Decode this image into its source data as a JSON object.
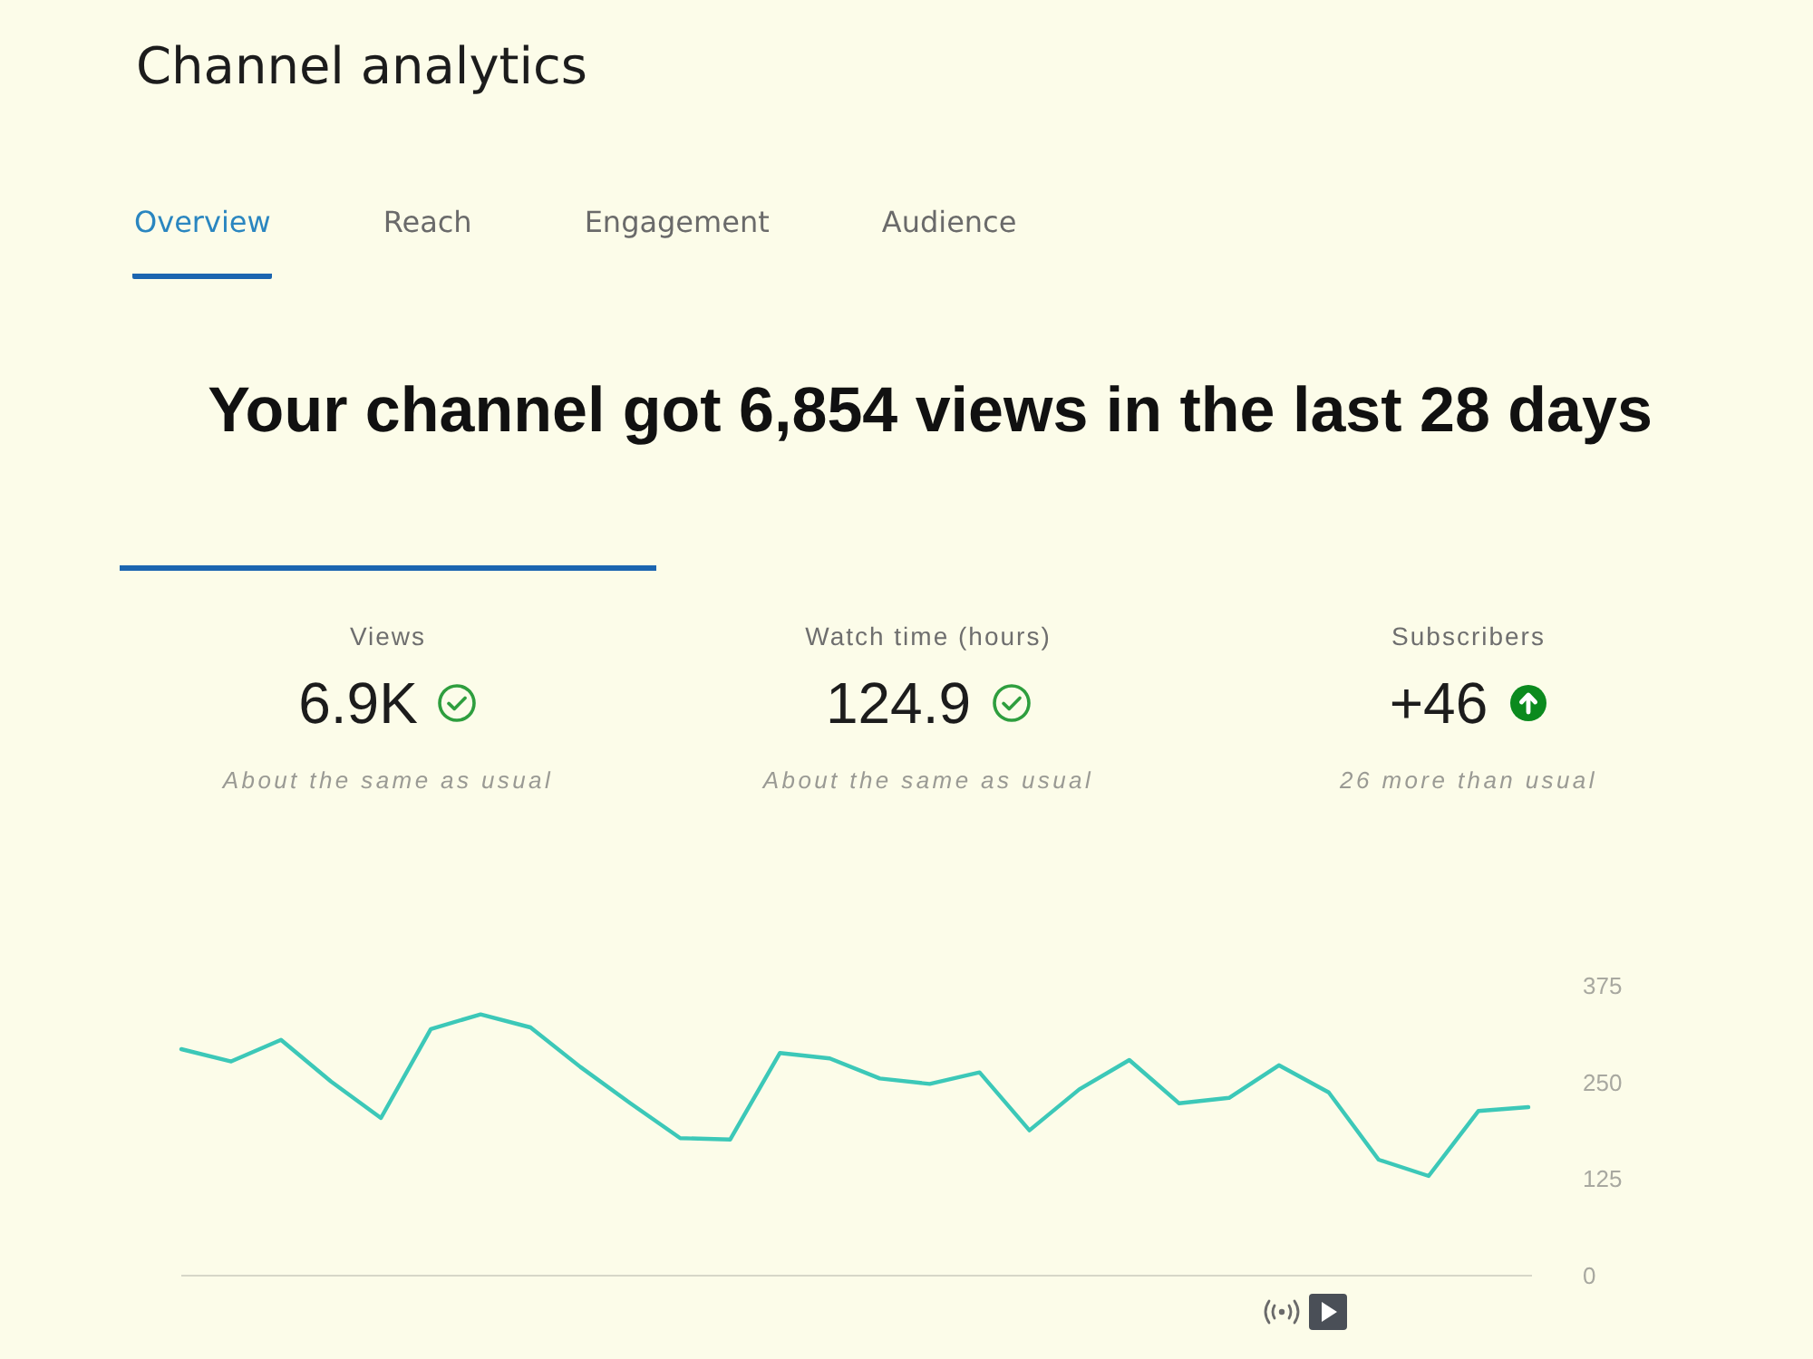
{
  "page": {
    "title": "Channel analytics"
  },
  "tabs": [
    {
      "label": "Overview",
      "selected": true
    },
    {
      "label": "Reach",
      "selected": false
    },
    {
      "label": "Engagement",
      "selected": false
    },
    {
      "label": "Audience",
      "selected": false
    }
  ],
  "headline": "Your channel got 6,854 views in the last 28 days",
  "metrics": [
    {
      "label": "Views",
      "value": "6.9K",
      "kind": "check",
      "note": "About the same as usual",
      "selected": true
    },
    {
      "label": "Watch time (hours)",
      "value": "124.9",
      "kind": "check",
      "note": "About the same as usual",
      "selected": false
    },
    {
      "label": "Subscribers",
      "value": "+46",
      "kind": "up",
      "note": "26 more than usual",
      "selected": false
    }
  ],
  "chart": {
    "chart_data": {
      "type": "line",
      "values": [
        293,
        277,
        305,
        251,
        204,
        319,
        338,
        321,
        270,
        223,
        178,
        176,
        288,
        281,
        255,
        248,
        263,
        188,
        241,
        279,
        223,
        230,
        272,
        237,
        150,
        129,
        213,
        218
      ],
      "color": "#3cc8b8",
      "ylim": [
        0,
        375
      ],
      "yticks": [
        0,
        125,
        250,
        375
      ],
      "tick_labels": "y"
    }
  }
}
